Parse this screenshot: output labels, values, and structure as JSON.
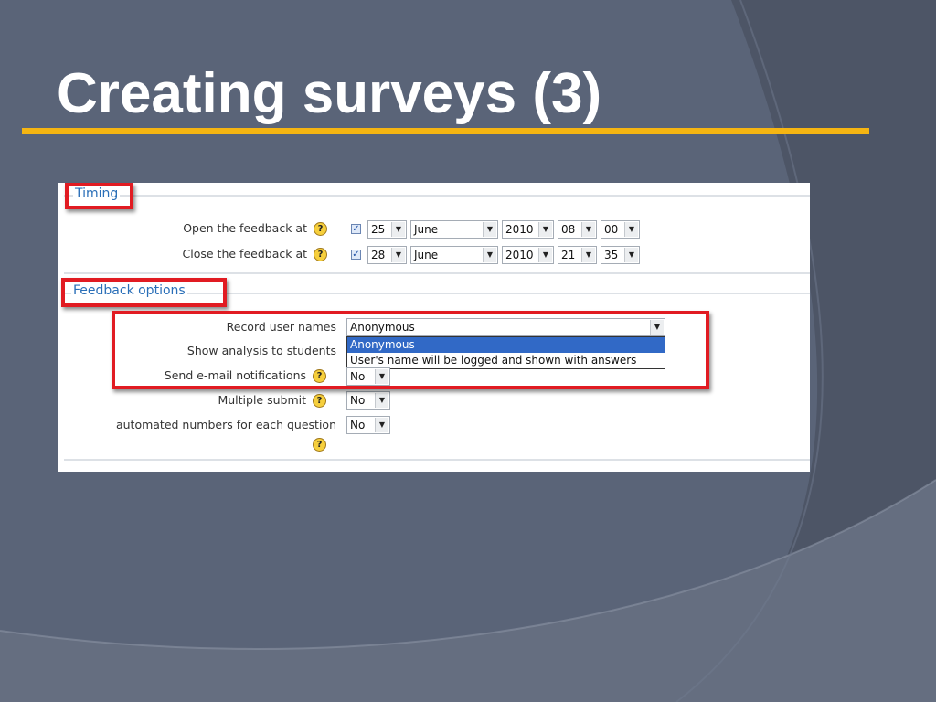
{
  "slide": {
    "title": "Creating surveys (3)"
  },
  "colors": {
    "accent_rule": "#f5b512",
    "highlight": "#e11b22",
    "legend": "#2a6fb8",
    "selected_option": "#3169c6"
  },
  "timing": {
    "legend": "Timing",
    "open": {
      "label": "Open the feedback at",
      "checked": true,
      "day": "25",
      "month": "June",
      "year": "2010",
      "hour": "08",
      "minute": "00"
    },
    "close": {
      "label": "Close the feedback at",
      "checked": true,
      "day": "28",
      "month": "June",
      "year": "2010",
      "hour": "21",
      "minute": "35"
    }
  },
  "feedback_options": {
    "legend": "Feedback options",
    "record_user_names": {
      "label": "Record user names",
      "value": "Anonymous",
      "options": [
        "Anonymous",
        "User's name will be logged and shown with answers"
      ]
    },
    "show_analysis": {
      "label": "Show analysis to students"
    },
    "send_email": {
      "label": "Send e-mail notifications",
      "value": "No"
    },
    "multiple_submit": {
      "label": "Multiple submit",
      "value": "No"
    },
    "automated_numbers": {
      "label": "automated numbers for each question",
      "value": "No"
    }
  },
  "icons": {
    "help": "?",
    "dropdown_arrow": "▼",
    "check": "✓"
  }
}
